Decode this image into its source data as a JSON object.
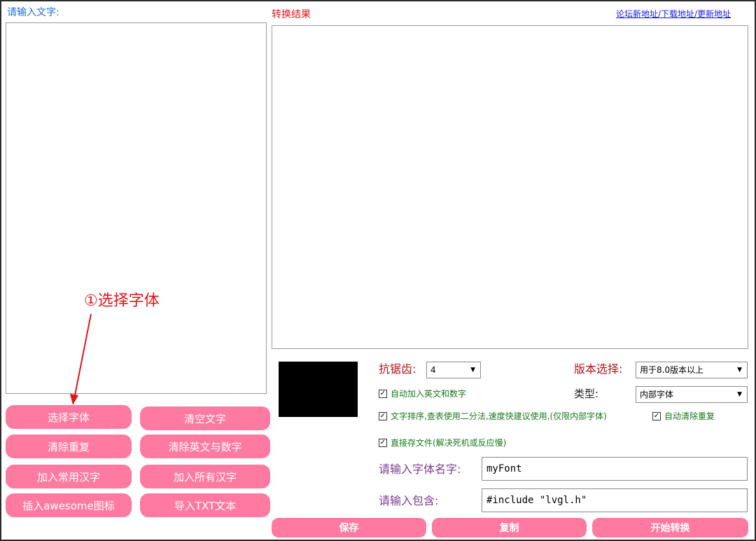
{
  "colors": {
    "accent_pink": "#ff7aa0",
    "label_blue": "#1e6fd9",
    "label_red": "#e0161b",
    "label_darkred": "#b01818",
    "label_purple": "#7b3c8f",
    "check_green": "#187a1c",
    "annotation_red": "#e0161b"
  },
  "input_panel": {
    "label": "请输入文字:"
  },
  "result_panel": {
    "label": "转换结果"
  },
  "top_link": {
    "text": "论坛新地址/下载地址/更新地址"
  },
  "buttons": {
    "select_font": "选择字体",
    "clear_text": "清空文字",
    "remove_duplicates": "清除重复",
    "remove_english_digits": "清除英文与数字",
    "add_common_chinese": "加入常用汉字",
    "add_all_chinese": "加入所有汉字",
    "insert_awesome": "插入awesome图标",
    "import_txt": "导入TXT文本"
  },
  "options": {
    "antialias_label": "抗锯齿:",
    "antialias_value": "4",
    "version_label": "版本选择:",
    "version_value": "用于8.0版本以上",
    "type_label": "类型:",
    "type_value": "内部字体",
    "auto_add_en_digits": "自动加入英文和数字",
    "sort_text": "文字排序,查表使用二分法,速度快建议使用,(仅限内部字体)",
    "auto_remove_dup": "自动清除重复",
    "direct_save": "直接存文件(解决死机或反应慢)",
    "checked_glyph": "✓"
  },
  "font_name": {
    "label": "请输入字体名字:",
    "value": "myFont"
  },
  "include": {
    "label": "请输入包含:",
    "value": "#include \"lvgl.h\""
  },
  "bottom_buttons": {
    "save": "保存",
    "copy": "复制",
    "start": "开始转换"
  },
  "annotation": {
    "text": "①选择字体"
  },
  "icons": {
    "dropdown": "chevron-down-icon",
    "checkbox": "checkbox-checked-icon"
  }
}
